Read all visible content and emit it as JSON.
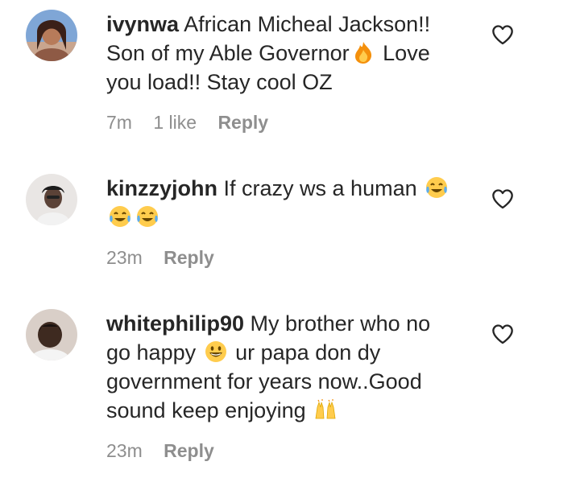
{
  "comments": [
    {
      "username": "ivynwa",
      "text_parts": [
        "African Micheal Jackson!! Son of my Able Governor",
        " Love you load!! Stay cool OZ"
      ],
      "time": "7m",
      "likes": "1 like",
      "reply_label": "Reply",
      "emoji": [
        "fire-emoji"
      ]
    },
    {
      "username": "kinzzyjohn",
      "text_parts": [
        "If crazy ws a human"
      ],
      "time": "23m",
      "reply_label": "Reply",
      "emoji": [
        "tears-of-joy-emoji",
        "tears-of-joy-emoji",
        "tears-of-joy-emoji"
      ]
    },
    {
      "username": "whitephilip90",
      "text_parts": [
        "My brother who no go happy",
        " ur papa don dy government for years now..Good sound keep enjoying"
      ],
      "time": "23m",
      "reply_label": "Reply",
      "emoji": [
        "grinning-face-emoji",
        "raising-hands-emoji"
      ]
    }
  ],
  "colors": {
    "text": "#262626",
    "meta": "#8e8e8e"
  }
}
